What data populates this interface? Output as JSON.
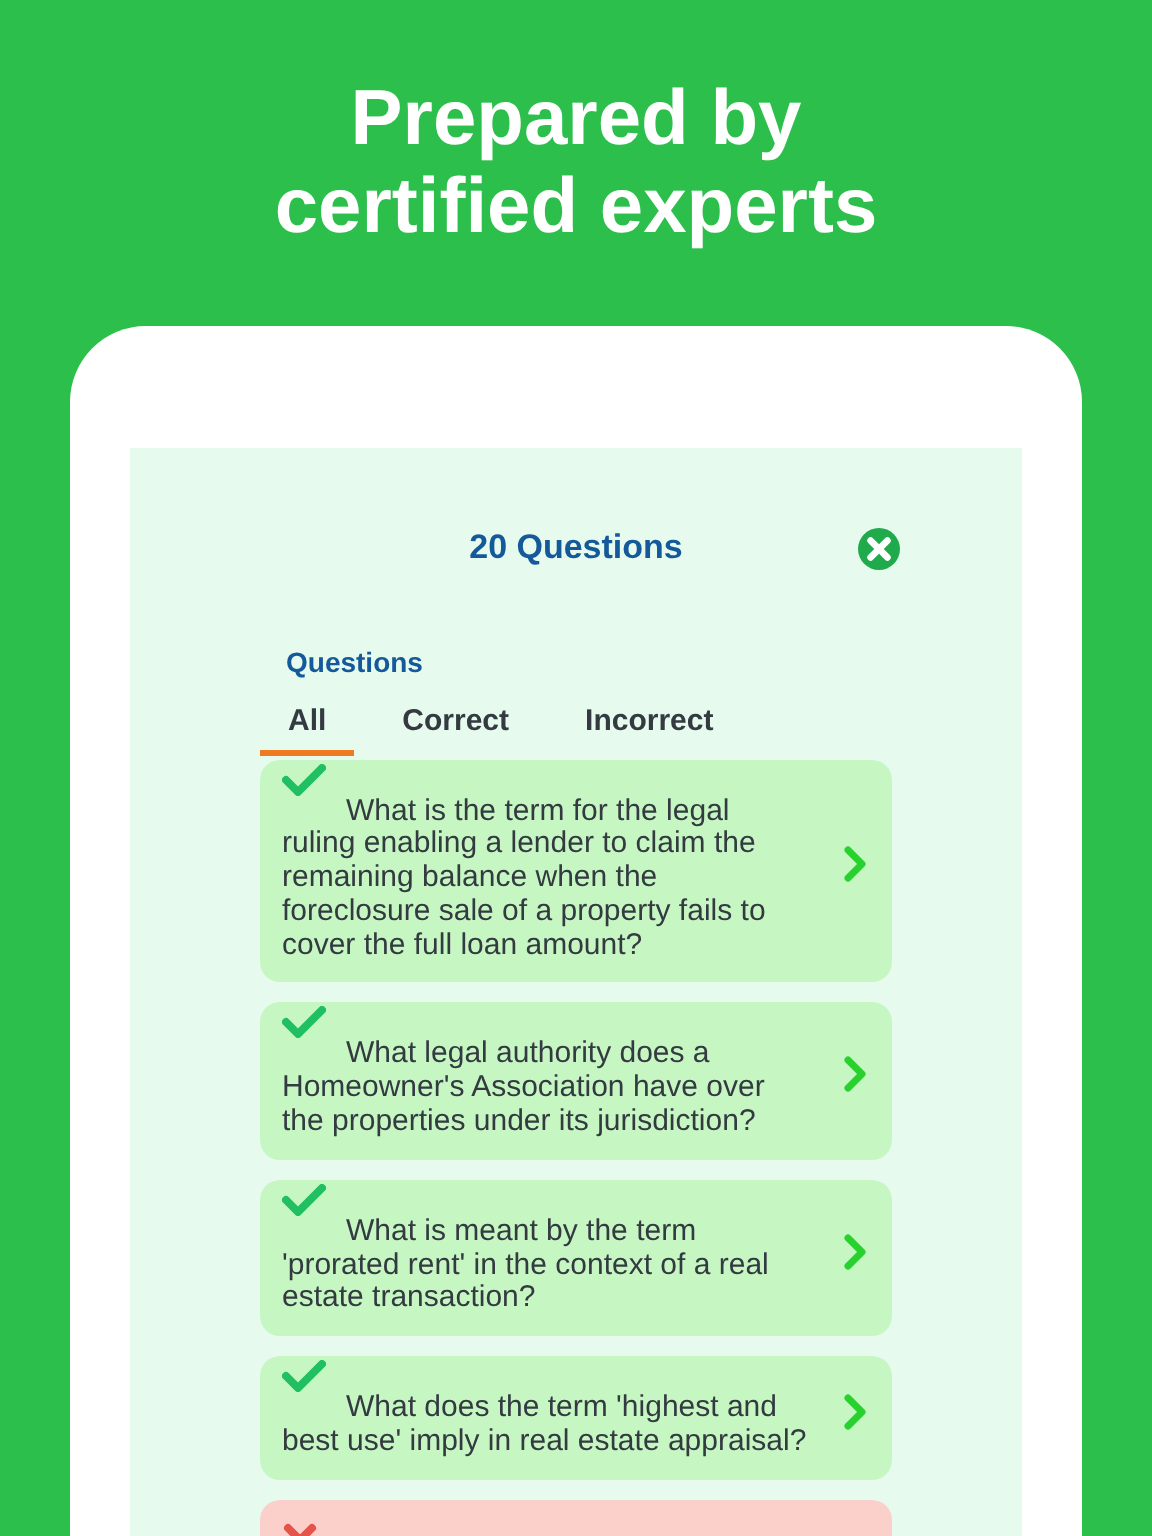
{
  "headline": "Prepared by certified experts",
  "screen": {
    "title": "20 Questions",
    "section_label": "Questions",
    "tabs": [
      {
        "label": "All",
        "selected": true
      },
      {
        "label": "Correct",
        "selected": false
      },
      {
        "label": "Incorrect",
        "selected": false
      }
    ],
    "questions": [
      {
        "correct": true,
        "text": "What is the term for the legal ruling enabling a lender to claim the remaining balance when the foreclosure sale of a property fails to cover the full loan amount?"
      },
      {
        "correct": true,
        "text": "What legal authority does a Homeowner's Association have over the properties under its jurisdiction?"
      },
      {
        "correct": true,
        "text": "What is meant by the term 'prorated rent' in the context of a real estate transaction?"
      },
      {
        "correct": true,
        "text": "What does the term 'highest and best use' imply in real estate appraisal?"
      },
      {
        "correct": false
      }
    ]
  }
}
